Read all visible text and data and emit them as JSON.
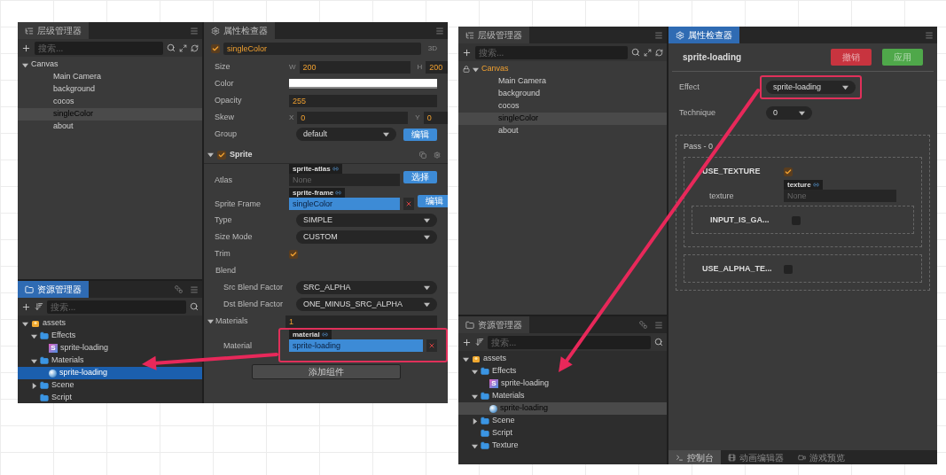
{
  "left_screenshot": {
    "hierarchy": {
      "tab": "层级管理器",
      "focused": false,
      "search": {
        "placeholder": "搜索..."
      },
      "tree": [
        {
          "label": "Canvas",
          "expanded": true,
          "current": false,
          "selected": false,
          "children": [
            {
              "label": "Main Camera",
              "selected": false
            },
            {
              "label": "background",
              "selected": false
            },
            {
              "label": "cocos",
              "selected": false
            },
            {
              "label": "singleColor",
              "selected": true
            },
            {
              "label": "about",
              "selected": false
            }
          ]
        }
      ]
    },
    "assets": {
      "tab": "资源管理器",
      "focused": true,
      "search": {
        "placeholder": "搜索..."
      },
      "tree": [
        {
          "label": "assets",
          "kind": "bundle",
          "expanded": true,
          "selected": false,
          "children": [
            {
              "label": "Effects",
              "kind": "folder",
              "expanded": true,
              "selected": false,
              "children": [
                {
                  "label": "sprite-loading",
                  "kind": "effect",
                  "badge": "S",
                  "selected": false
                }
              ]
            },
            {
              "label": "Materials",
              "kind": "folder",
              "expanded": true,
              "selected": false,
              "children": [
                {
                  "label": "sprite-loading",
                  "kind": "material",
                  "selected": true
                }
              ]
            },
            {
              "label": "Scene",
              "kind": "folder",
              "expanded": false,
              "selected": false
            },
            {
              "label": "Script",
              "kind": "folder",
              "selected": false
            }
          ]
        }
      ]
    },
    "inspector": {
      "tab": "属性检查器",
      "focused": false,
      "node": {
        "enabled": true,
        "name": "singleColor",
        "mode": "3D"
      },
      "rows": [
        {
          "kind": "pair",
          "label": "Size",
          "a_label": "W",
          "a": "200",
          "b_label": "H",
          "b": "200"
        },
        {
          "kind": "color",
          "label": "Color",
          "color": "#ffffff"
        },
        {
          "kind": "number",
          "label": "Opacity",
          "value": "255"
        },
        {
          "kind": "pair",
          "label": "Skew",
          "a_label": "X",
          "a": "0",
          "b_label": "Y",
          "b": "0"
        },
        {
          "kind": "select",
          "label": "Group",
          "value": "default",
          "button": "编辑"
        }
      ],
      "component": {
        "name": "Sprite",
        "enabled": true,
        "expanded": true,
        "rows": [
          {
            "kind": "asset",
            "label": "Atlas",
            "tag": "sprite-atlas",
            "placeholder": "None",
            "button": "选择"
          },
          {
            "kind": "asset",
            "label": "Sprite Frame",
            "tag": "sprite-frame",
            "value": "singleColor",
            "removable": true,
            "button": "编辑"
          },
          {
            "kind": "select",
            "label": "Type",
            "value": "SIMPLE"
          },
          {
            "kind": "select",
            "label": "Size Mode",
            "value": "CUSTOM"
          },
          {
            "kind": "checkbox",
            "label": "Trim",
            "checked": true
          },
          {
            "kind": "group",
            "label": "Blend",
            "children": [
              {
                "kind": "select",
                "label": "Src Blend Factor",
                "value": "SRC_ALPHA"
              },
              {
                "kind": "select",
                "label": "Dst Blend Factor",
                "value": "ONE_MINUS_SRC_ALPHA"
              }
            ]
          },
          {
            "kind": "group",
            "label": "Materials",
            "expanded": true,
            "value": "1",
            "children": [
              {
                "kind": "asset",
                "label": "Material",
                "tag": "material",
                "value": "sprite-loading",
                "removable": true,
                "highlighted": true
              }
            ]
          }
        ]
      },
      "add_button": "添加组件"
    }
  },
  "right_screenshot": {
    "hierarchy": {
      "tab": "层级管理器",
      "focused": false,
      "search": {
        "placeholder": "搜索..."
      },
      "tree": [
        {
          "label": "Canvas",
          "expanded": true,
          "current": true,
          "locked": true,
          "selected": false,
          "children": [
            {
              "label": "Main Camera",
              "selected": false
            },
            {
              "label": "background",
              "selected": false
            },
            {
              "label": "cocos",
              "selected": false
            },
            {
              "label": "singleColor",
              "selected": true
            },
            {
              "label": "about",
              "selected": false
            }
          ]
        }
      ]
    },
    "assets": {
      "tab": "资源管理器",
      "focused": false,
      "search": {
        "placeholder": "搜索..."
      },
      "tree": [
        {
          "label": "assets",
          "kind": "bundle",
          "expanded": true,
          "selected": false,
          "children": [
            {
              "label": "Effects",
              "kind": "folder",
              "expanded": true,
              "selected": false,
              "children": [
                {
                  "label": "sprite-loading",
                  "kind": "effect",
                  "badge": "S",
                  "selected": false
                }
              ]
            },
            {
              "label": "Materials",
              "kind": "folder",
              "expanded": true,
              "selected": false,
              "children": [
                {
                  "label": "sprite-loading",
                  "kind": "material",
                  "selected": true
                }
              ]
            },
            {
              "label": "Scene",
              "kind": "folder",
              "expanded": false,
              "selected": false
            },
            {
              "label": "Script",
              "kind": "folder",
              "selected": false
            },
            {
              "label": "Texture",
              "kind": "folder",
              "expanded": true,
              "selected": false
            }
          ]
        }
      ]
    },
    "inspector": {
      "tab": "属性检查器",
      "focused": true,
      "title": "sprite-loading",
      "buttons": [
        {
          "label": "撤销",
          "color": "#c8343f"
        },
        {
          "label": "应用",
          "color": "#4fa84a"
        }
      ],
      "rows": [
        {
          "label": "Effect",
          "value": "sprite-loading",
          "highlighted": true
        },
        {
          "label": "Technique",
          "value": "0"
        }
      ],
      "pass": {
        "title": "Pass - 0",
        "defines": [
          {
            "label": "USE_TEXTURE",
            "checked": true,
            "children": [
              {
                "kind": "asset",
                "label": "texture",
                "tag": "texture",
                "placeholder": "None"
              },
              {
                "kind": "define",
                "label": "INPUT_IS_GA...",
                "checked": false
              }
            ]
          },
          {
            "label": "USE_ALPHA_TE...",
            "checked": false
          }
        ]
      }
    },
    "bottom_tabs": [
      {
        "label": "控制台",
        "selected": true
      },
      {
        "label": "动画编辑器",
        "selected": false
      },
      {
        "label": "游戏预览",
        "selected": false
      }
    ]
  }
}
